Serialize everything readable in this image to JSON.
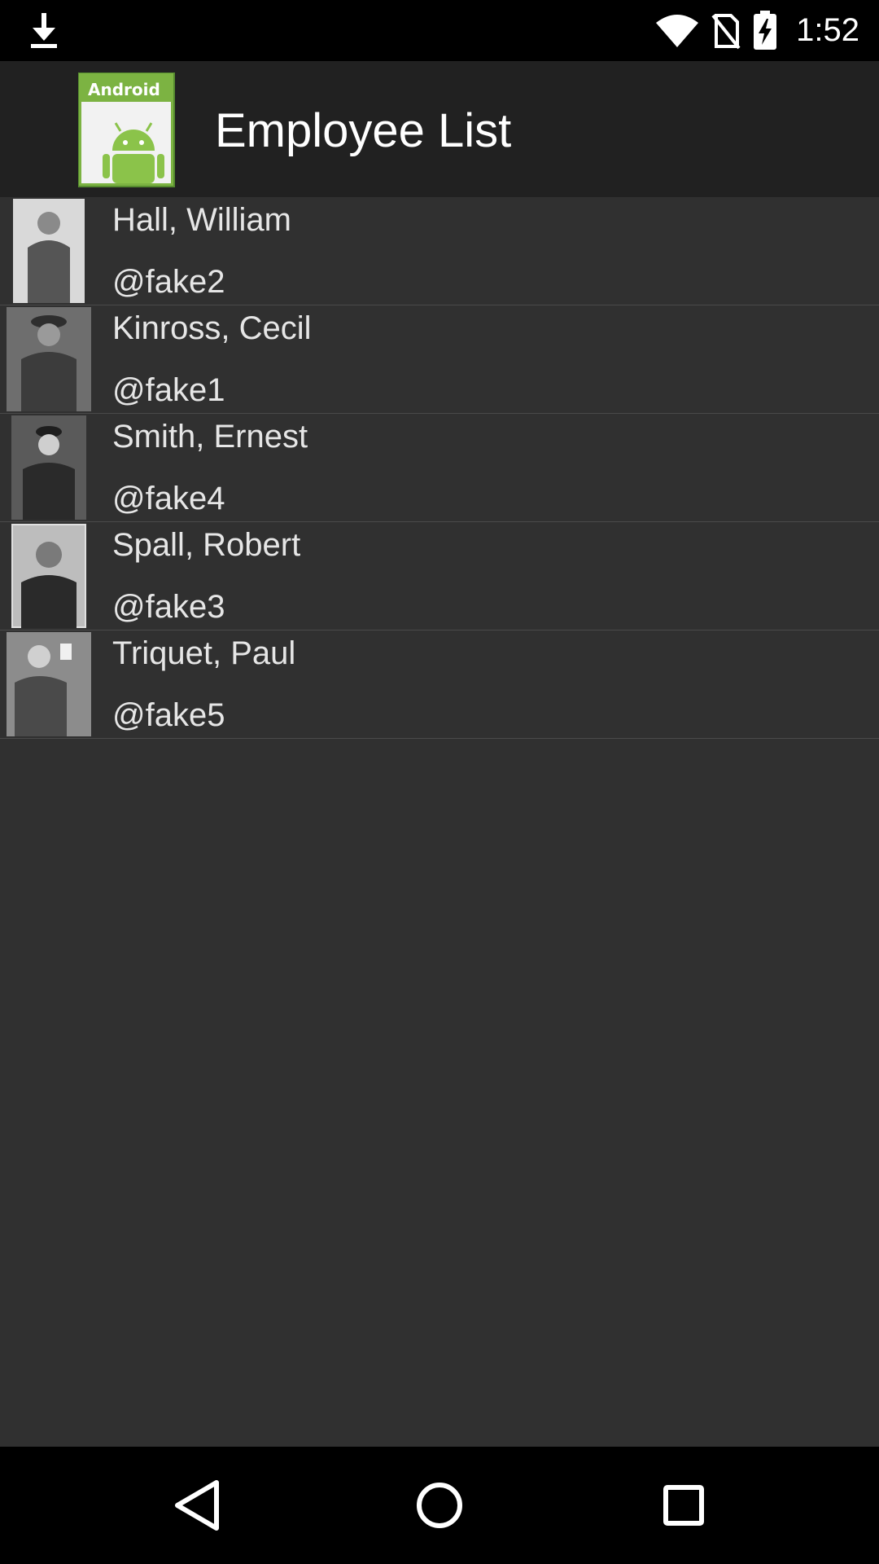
{
  "status_bar": {
    "time": "1:52",
    "icons": [
      "download-icon",
      "wifi-icon",
      "no-sim-icon",
      "battery-charging-icon"
    ]
  },
  "app_bar": {
    "title": "Employee List",
    "icon": "android-app-icon",
    "icon_label": "Android"
  },
  "employees": [
    {
      "name": "Hall, William",
      "handle": "@fake2"
    },
    {
      "name": "Kinross, Cecil",
      "handle": "@fake1"
    },
    {
      "name": "Smith, Ernest",
      "handle": "@fake4"
    },
    {
      "name": "Spall, Robert",
      "handle": "@fake3"
    },
    {
      "name": "Triquet, Paul",
      "handle": "@fake5"
    }
  ],
  "nav_bar": {
    "icons": [
      "back-icon",
      "home-icon",
      "recents-icon"
    ]
  },
  "colors": {
    "background": "#303030",
    "app_bar": "#212121",
    "status_bar": "#000000",
    "android_green": "#8bc34a"
  }
}
